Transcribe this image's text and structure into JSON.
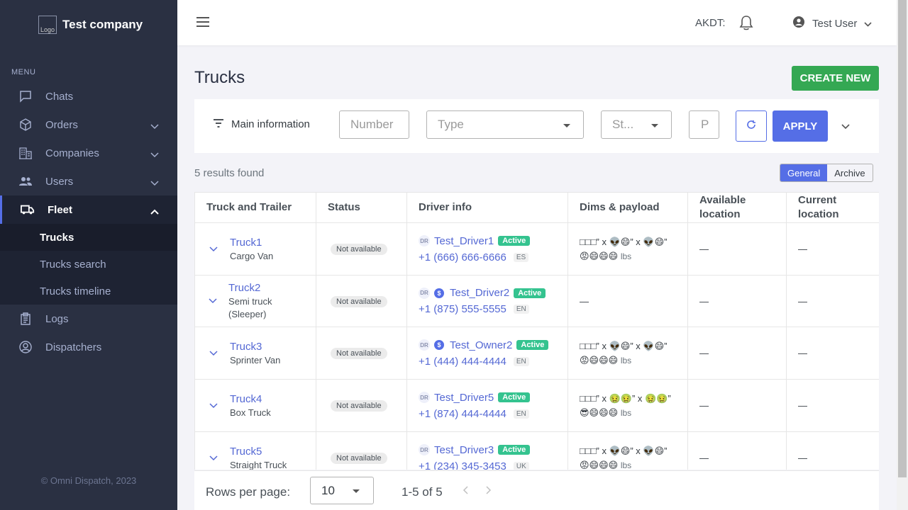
{
  "brand": {
    "logo_alt": "Logo",
    "name": "Test company"
  },
  "sidebar": {
    "menu_title": "MENU",
    "items": [
      {
        "label": "Chats",
        "icon": "chat-icon"
      },
      {
        "label": "Orders",
        "icon": "box-icon"
      },
      {
        "label": "Companies",
        "icon": "building-icon"
      },
      {
        "label": "Users",
        "icon": "users-icon"
      },
      {
        "label": "Fleet",
        "icon": "truck-icon"
      },
      {
        "label": "Logs",
        "icon": "clipboard-icon"
      },
      {
        "label": "Dispatchers",
        "icon": "user-circle-icon"
      }
    ],
    "fleet_sub": [
      "Trucks",
      "Trucks search",
      "Trucks timeline"
    ],
    "copyright": "© Omni Dispatch, 2023"
  },
  "topbar": {
    "timezone": "AKDT:",
    "user_name": "Test User"
  },
  "page": {
    "title": "Trucks",
    "create_label": "CREATE NEW"
  },
  "filters": {
    "toggle_label": "Main information",
    "number_placeholder": "Number",
    "type_placeholder": "Type",
    "status_placeholder": "St...",
    "extra_placeholder": "P",
    "apply_label": "APPLY"
  },
  "results": {
    "text": "5 results found",
    "view_general": "General",
    "view_archive": "Archive"
  },
  "table": {
    "headers": [
      "Truck and Trailer",
      "Status",
      "Driver info",
      "Dims & payload",
      "Available location",
      "Current location"
    ],
    "rows": [
      {
        "truck": "Truck1",
        "type": "Cargo Van",
        "status": "Not available",
        "dr": "DR",
        "driver": "Test_Driver1",
        "driver_status": "Active",
        "phone": "+1 (666) 666-6666",
        "lang": "ES",
        "dims": "□□□” x 👽😄” x 👽😄”",
        "payload": "😡😄😄😄",
        "unit": "lbs",
        "available": "—",
        "current": "—"
      },
      {
        "truck": "Truck2",
        "type": "Semi truck (Sleeper)",
        "status": "Not available",
        "dr": "DR",
        "owner": "$",
        "driver": "Test_Driver2",
        "driver_status": "Active",
        "phone": "+1 (875) 555-5555",
        "lang": "EN",
        "dims_dash": "—",
        "available": "—",
        "current": "—"
      },
      {
        "truck": "Truck3",
        "type": "Sprinter Van",
        "status": "Not available",
        "dr": "DR",
        "owner": "$",
        "driver": "Test_Owner2",
        "driver_status": "Active",
        "phone": "+1 (444) 444-4444",
        "lang": "EN",
        "dims": "□□□” x 👽😄” x 👽😄”",
        "payload": "😡😄😄😄",
        "unit": "lbs",
        "available": "—",
        "current": "—"
      },
      {
        "truck": "Truck4",
        "type": "Box Truck",
        "status": "Not available",
        "dr": "DR",
        "driver": "Test_Driver5",
        "driver_status": "Active",
        "phone": "+1 (874) 444-4444",
        "lang": "EN",
        "dims": "□□□” x 🤢🤢” x 🤢🤢”",
        "payload": "😎😄😄😄",
        "unit": "lbs",
        "available": "—",
        "current": "—"
      },
      {
        "truck": "Truck5",
        "type": "Straight Truck",
        "status": "Not available",
        "dr": "DR",
        "driver": "Test_Driver3",
        "driver_status": "Active",
        "phone": "+1 (234) 345-3453",
        "lang": "UK",
        "dims": "□□□” x 👽😄” x 👽😄”",
        "payload": "😡😄😄😄",
        "unit": "lbs",
        "available": "—",
        "current": "—"
      }
    ]
  },
  "pagination": {
    "rows_label": "Rows per page:",
    "rows_value": "10",
    "range": "1-5 of 5"
  }
}
